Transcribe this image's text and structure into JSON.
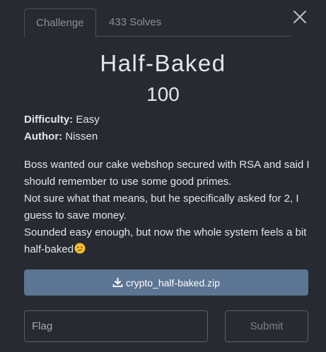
{
  "tabs": [
    {
      "label": "Challenge",
      "active": true
    },
    {
      "label": "433 Solves",
      "active": false
    }
  ],
  "challenge": {
    "name": "Half-Baked",
    "points": "100",
    "difficulty_label": "Difficulty:",
    "difficulty": "Easy",
    "author_label": "Author:",
    "author": "Nissen",
    "description": [
      "Boss wanted our cake webshop secured with RSA and said I should remember to use some good primes.",
      "Not sure what that means, but he specifically asked for 2, I guess to save money.",
      "Sounded easy enough, but now the whole system feels a bit half-baked"
    ],
    "description_emoji": "confused-face-icon"
  },
  "attachment": {
    "icon": "download-icon",
    "filename": "crypto_half-baked.zip"
  },
  "form": {
    "flag_placeholder": "Flag",
    "flag_value": "",
    "submit_label": "Submit"
  },
  "colors": {
    "background": "#272a30",
    "download_button": "#5c7592",
    "border": "#5a5f68"
  }
}
